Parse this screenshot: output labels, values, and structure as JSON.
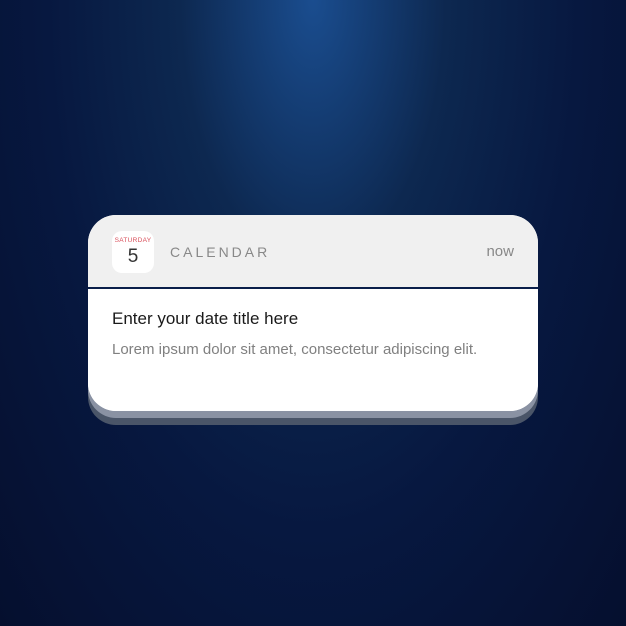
{
  "notification": {
    "header": {
      "date_icon": {
        "day_name": "Saturday",
        "day_number": "5"
      },
      "app_name": "CALENDAR",
      "timestamp": "now"
    },
    "body": {
      "title": "Enter your date title here",
      "description": "Lorem ipsum dolor sit amet, consectetur adipiscing elit."
    }
  }
}
